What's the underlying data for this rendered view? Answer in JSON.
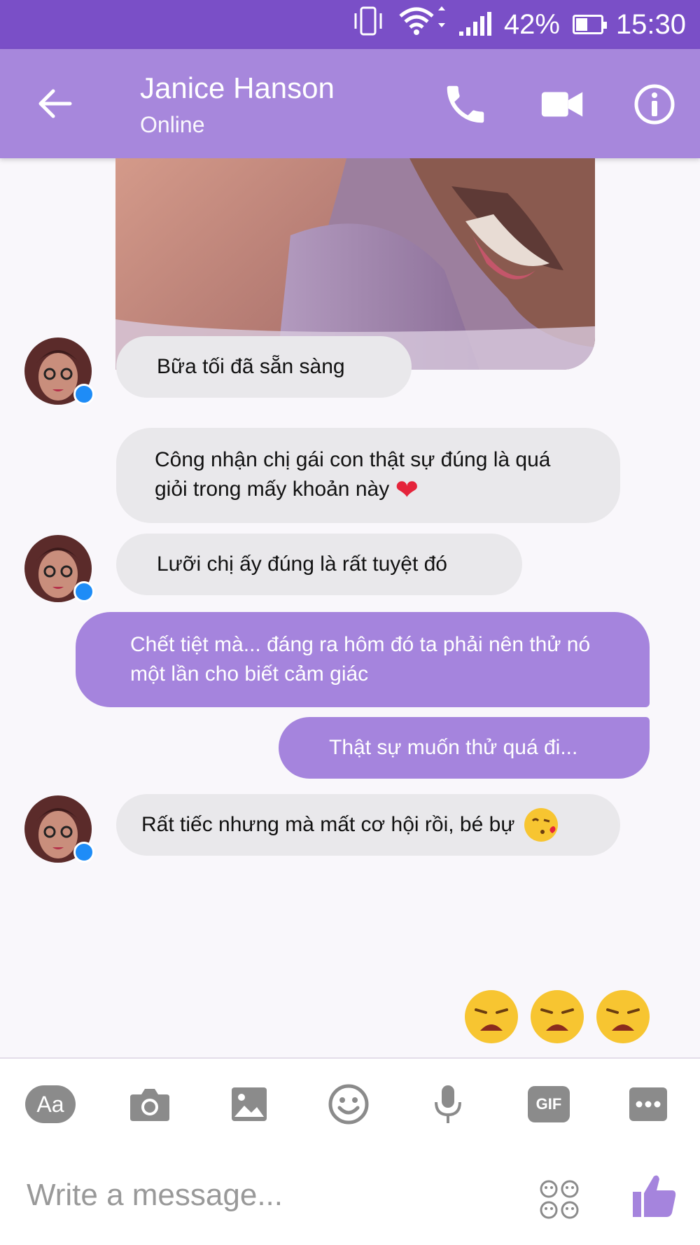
{
  "status_bar": {
    "battery": "42%",
    "battery_level": 0.42,
    "time": "15:30"
  },
  "header": {
    "contact_name": "Janice Hanson",
    "contact_status": "Online"
  },
  "messages": [
    {
      "side": "in",
      "text": "Bữa tối đã sẵn sàng"
    },
    {
      "side": "in",
      "text": "Công nhận chị gái con thật sự đúng là quá giỏi trong mấy khoản này"
    },
    {
      "side": "in",
      "text": "Lưỡi chị ấy đúng là rất tuyệt đó"
    },
    {
      "side": "out",
      "text": "Chết tiệt mà... đáng ra hôm đó ta phải nên thử nó một lần cho biết cảm giác"
    },
    {
      "side": "out",
      "text": "Thật sự muốn thử quá đi..."
    },
    {
      "side": "in",
      "text": "Rất tiếc nhưng mà mất cơ hội rồi, bé bự"
    }
  ],
  "composer": {
    "aa_label": "Aa",
    "gif_label": "GIF",
    "placeholder": "Write a message..."
  },
  "colors": {
    "status_bar": "#7a4fc7",
    "header": "#a787dc",
    "outgoing": "#a584dd",
    "incoming": "#e9e8eb",
    "icon_gray": "#8b8b8b"
  }
}
